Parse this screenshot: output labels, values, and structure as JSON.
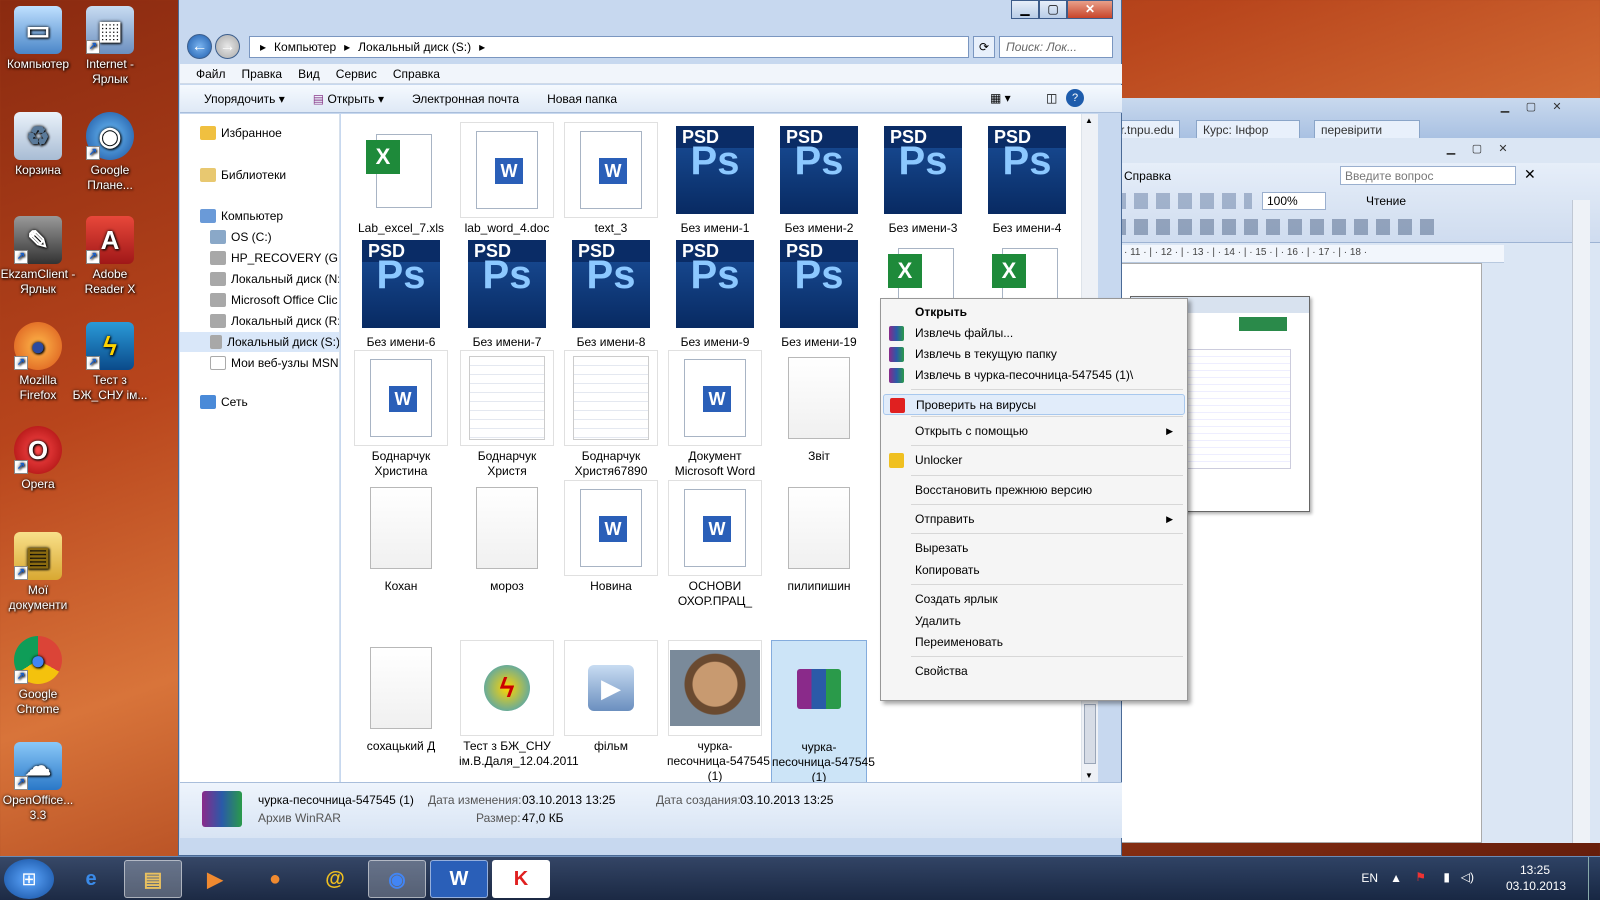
{
  "desktop": {
    "icons": [
      {
        "label": "Компьютер",
        "icon": "computer-icon"
      },
      {
        "label": "Internet - Ярлык",
        "icon": "internet-shortcut-icon"
      },
      {
        "label": "Корзина",
        "icon": "recycle-bin-icon"
      },
      {
        "label": "Google Плане...",
        "icon": "google-earth-icon"
      },
      {
        "label": "EkzamClient - Ярлык",
        "icon": "ekzamclient-icon"
      },
      {
        "label": "Adobe Reader X",
        "icon": "adobe-reader-icon"
      },
      {
        "label": "Mozilla Firefox",
        "icon": "firefox-icon"
      },
      {
        "label": "Тест з БЖ_СНУ ім...",
        "icon": "test-app-icon"
      },
      {
        "label": "Opera",
        "icon": "opera-icon"
      },
      {
        "label": "Мої документи",
        "icon": "folder-icon"
      },
      {
        "label": "Google Chrome",
        "icon": "chrome-icon"
      },
      {
        "label": "OpenOffice... 3.3",
        "icon": "openoffice-icon"
      }
    ]
  },
  "background_window": {
    "tabs": [
      "dlr.tnpu.edu",
      "Курс: Інфор",
      "перевірити"
    ],
    "menu_item": "Справка",
    "question_placeholder": "Введите вопрос",
    "zoom": "100%",
    "reading_button": "Чтение",
    "ruler": "· 11 · | · 12 · | · 13 · | · 14 · | · 15 · | · 16 · | · 17 · | · 18 ·"
  },
  "explorer": {
    "address": {
      "crumbs": [
        "Компьютер",
        "Локальный диск (S:)"
      ],
      "search_placeholder": "Поиск: Лок..."
    },
    "menubar": [
      "Файл",
      "Правка",
      "Вид",
      "Сервис",
      "Справка"
    ],
    "commands": [
      "Упорядочить",
      "Открыть",
      "Электронная почта",
      "Новая папка"
    ],
    "nav": {
      "favorites": "Избранное",
      "libraries": "Библиотеки",
      "computer": "Компьютер",
      "drives": [
        "OS (C:)",
        "HP_RECOVERY (G:)",
        "Локальный диск (N:",
        "Microsoft Office Clic",
        "Локальный диск (R:",
        "Локальный диск (S:)",
        "Мои веб-узлы MSN"
      ],
      "network": "Сеть"
    },
    "files": [
      {
        "name": "Lab_excel_7.xls",
        "type": "xls"
      },
      {
        "name": "lab_word_4.doc",
        "type": "doc"
      },
      {
        "name": "text_3",
        "type": "doc"
      },
      {
        "name": "Без имени-1",
        "type": "psd"
      },
      {
        "name": "Без имени-2",
        "type": "psd"
      },
      {
        "name": "Без имени-3",
        "type": "psd"
      },
      {
        "name": "Без имени-4",
        "type": "psd"
      },
      {
        "name": "Без имени-6",
        "type": "psd"
      },
      {
        "name": "Без имени-7",
        "type": "psd"
      },
      {
        "name": "Без имени-8",
        "type": "psd"
      },
      {
        "name": "Без имени-9",
        "type": "psd"
      },
      {
        "name": "Без имени-19",
        "type": "psd"
      },
      {
        "name": "",
        "type": "xls"
      },
      {
        "name": "",
        "type": "xls"
      },
      {
        "name": "Боднарчук Христина",
        "type": "doc"
      },
      {
        "name": "Боднарчук Христя",
        "type": "image"
      },
      {
        "name": "Боднарчук Христя67890",
        "type": "image"
      },
      {
        "name": "Документ Microsoft Word",
        "type": "doc"
      },
      {
        "name": "Звіт",
        "type": "blank"
      },
      {
        "name": "Кохан",
        "type": "blank"
      },
      {
        "name": "мороз",
        "type": "blank"
      },
      {
        "name": "Новина",
        "type": "doc"
      },
      {
        "name": "ОСНОВИ ОХОР.ПРАЦ_",
        "type": "doc"
      },
      {
        "name": "пилипишин",
        "type": "blank"
      },
      {
        "name": "сохацький Д",
        "type": "blank"
      },
      {
        "name": "Тест з БЖ_СНУ ім.В.Даля_12.04.2011",
        "type": "app"
      },
      {
        "name": "фільм",
        "type": "video"
      },
      {
        "name": "чурка-песочница-547545 (1)",
        "type": "photo"
      },
      {
        "name": "чурка-песочница-547545 (1)",
        "type": "rar"
      }
    ],
    "status": {
      "name": "чурка-песочница-547545 (1)",
      "type": "Архив WinRAR",
      "modified_label": "Дата изменения:",
      "modified": "03.10.2013 13:25",
      "created_label": "Дата создания:",
      "created": "03.10.2013 13:25",
      "size_label": "Размер:",
      "size": "47,0 КБ"
    }
  },
  "context_menu": {
    "items": [
      {
        "label": "Открыть",
        "bold": true
      },
      {
        "label": "Извлечь файлы...",
        "icon": "winrar-icon"
      },
      {
        "label": "Извлечь в текущую папку",
        "icon": "winrar-icon"
      },
      {
        "label": "Извлечь в чурка-песочница-547545 (1)\\",
        "icon": "winrar-icon"
      },
      {
        "label": "Проверить на вирусы",
        "icon": "kaspersky-icon"
      },
      {
        "label": "Открыть с помощью",
        "submenu": true
      },
      {
        "label": "Unlocker",
        "icon": "unlocker-icon"
      },
      {
        "label": "Восстановить прежнюю версию"
      },
      {
        "label": "Отправить",
        "submenu": true
      },
      {
        "label": "Вырезать"
      },
      {
        "label": "Копировать"
      },
      {
        "label": "Создать ярлык"
      },
      {
        "label": "Удалить"
      },
      {
        "label": "Переименовать"
      },
      {
        "label": "Свойства"
      }
    ]
  },
  "taskbar": {
    "apps": [
      "internet-explorer-icon",
      "explorer-icon",
      "media-player-icon",
      "firefox-icon",
      "mail-icon",
      "chrome-icon",
      "word-icon",
      "kaspersky-icon"
    ],
    "lang": "EN",
    "time": "13:25",
    "date": "03.10.2013"
  }
}
